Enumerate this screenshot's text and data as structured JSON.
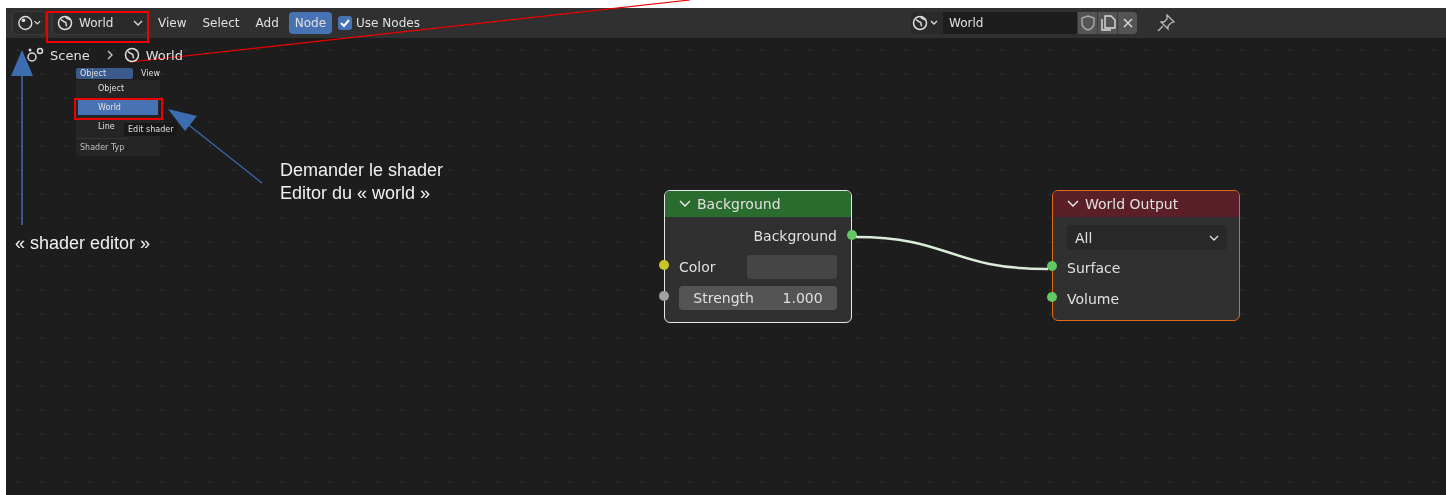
{
  "header": {
    "shader_type": {
      "label": "World"
    },
    "menus": [
      {
        "label": "View",
        "selected": false
      },
      {
        "label": "Select",
        "selected": false
      },
      {
        "label": "Add",
        "selected": false
      },
      {
        "label": "Node",
        "selected": true
      }
    ],
    "use_nodes": {
      "label": "Use Nodes",
      "checked": true
    },
    "world_selector": {
      "value": "World"
    }
  },
  "breadcrumb": [
    "Scene",
    "World"
  ],
  "inset_menu": {
    "dropdown": "Object",
    "menu": "View",
    "items": [
      {
        "label": "Object",
        "selected": false
      },
      {
        "label": "World",
        "selected": true
      },
      {
        "label": "Line",
        "selected": false
      }
    ],
    "tooltip": "Edit shader",
    "footer": "Shader Typ"
  },
  "nodes": [
    {
      "kind": "background",
      "title": "Background",
      "outputs": [
        {
          "label": "Background",
          "color": "#63c763"
        }
      ],
      "inputs": [
        {
          "kind": "color",
          "label": "Color",
          "color": "#c7c729"
        },
        {
          "kind": "value",
          "label": "Strength",
          "value": "1.000",
          "color": "#a1a1a1"
        }
      ]
    },
    {
      "kind": "output",
      "title": "World Output",
      "dropdown": "All",
      "inputs": [
        {
          "kind": "socket",
          "label": "Surface",
          "color": "#63c763"
        },
        {
          "kind": "socket",
          "label": "Volume",
          "color": "#63c763"
        }
      ]
    }
  ],
  "annotations": [
    {
      "kind": "right",
      "lines": [
        "Demander le shader",
        "Editor du « world »"
      ]
    },
    {
      "kind": "left",
      "lines": [
        "« shader editor »"
      ]
    }
  ]
}
